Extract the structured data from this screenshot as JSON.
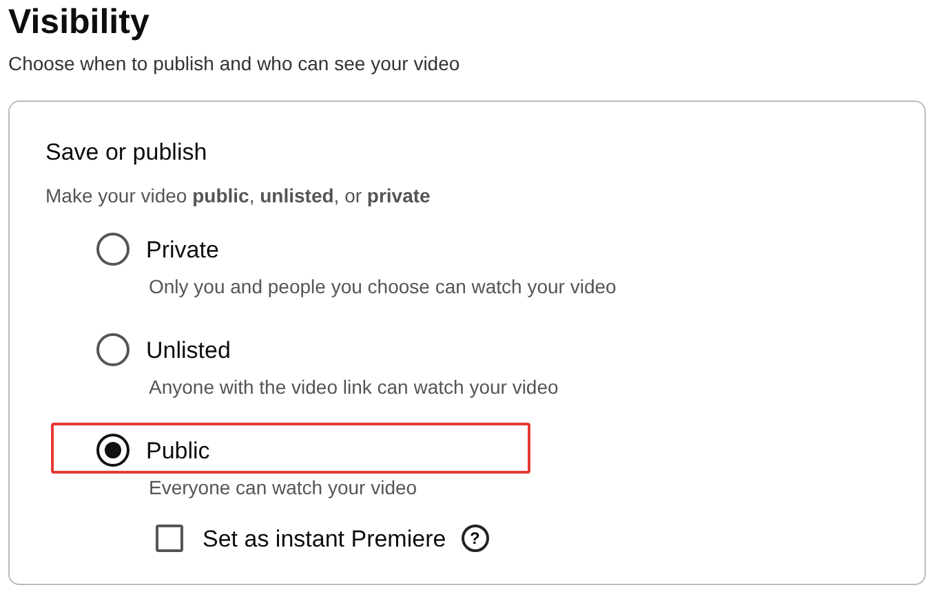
{
  "title": "Visibility",
  "subtitle": "Choose when to publish and who can see your video",
  "section": {
    "title": "Save or publish",
    "description": "Make your video **public**, **unlisted**, or **private**"
  },
  "options": [
    {
      "label": "Private",
      "description": "Only you and people you choose can watch your video",
      "selected": false,
      "highlighted": false
    },
    {
      "label": "Unlisted",
      "description": "Anyone with the video link can watch your video",
      "selected": false,
      "highlighted": false
    },
    {
      "label": "Public",
      "description": "Everyone can watch your video",
      "selected": true,
      "highlighted": true
    }
  ],
  "premiere": {
    "label": "Set as instant Premiere",
    "checked": false,
    "help": "?"
  }
}
